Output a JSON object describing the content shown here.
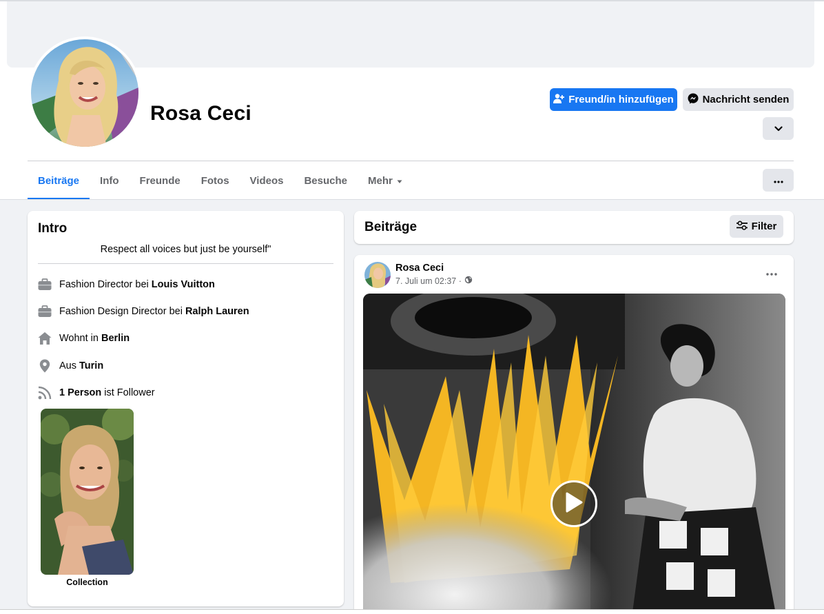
{
  "profile": {
    "name": "Rosa Ceci"
  },
  "actions": {
    "add_friend": "Freund/in hinzufügen",
    "message": "Nachricht senden"
  },
  "tabs": [
    {
      "label": "Beiträge",
      "active": true
    },
    {
      "label": "Info"
    },
    {
      "label": "Freunde"
    },
    {
      "label": "Fotos"
    },
    {
      "label": "Videos"
    },
    {
      "label": "Besuche"
    },
    {
      "label": "Mehr"
    }
  ],
  "intro": {
    "title": "Intro",
    "bio": "Respect all voices but just be yourself\"",
    "rows": [
      {
        "icon": "briefcase-icon",
        "pre": "Fashion Director bei ",
        "bold": "Louis Vuitton",
        "post": ""
      },
      {
        "icon": "briefcase-icon",
        "pre": "Fashion Design Director bei ",
        "bold": "Ralph Lauren",
        "post": ""
      },
      {
        "icon": "home-icon",
        "pre": "Wohnt in ",
        "bold": "Berlin",
        "post": ""
      },
      {
        "icon": "location-pin-icon",
        "pre": "Aus ",
        "bold": "Turin",
        "post": ""
      },
      {
        "icon": "rss-icon",
        "pre": "",
        "bold": "1 Person",
        "post": " ist Follower"
      }
    ],
    "featured_label": "Collection"
  },
  "posts": {
    "title": "Beiträge",
    "filter_label": "Filter"
  },
  "post": {
    "author": "Rosa Ceci",
    "time": "7. Juli um 02:37 ·",
    "privacy_icon": "globe-icon"
  },
  "colors": {
    "accent": "#1877f2",
    "background": "#f0f2f5",
    "secondary_button": "#e4e6eb",
    "muted_text": "#65676b"
  }
}
